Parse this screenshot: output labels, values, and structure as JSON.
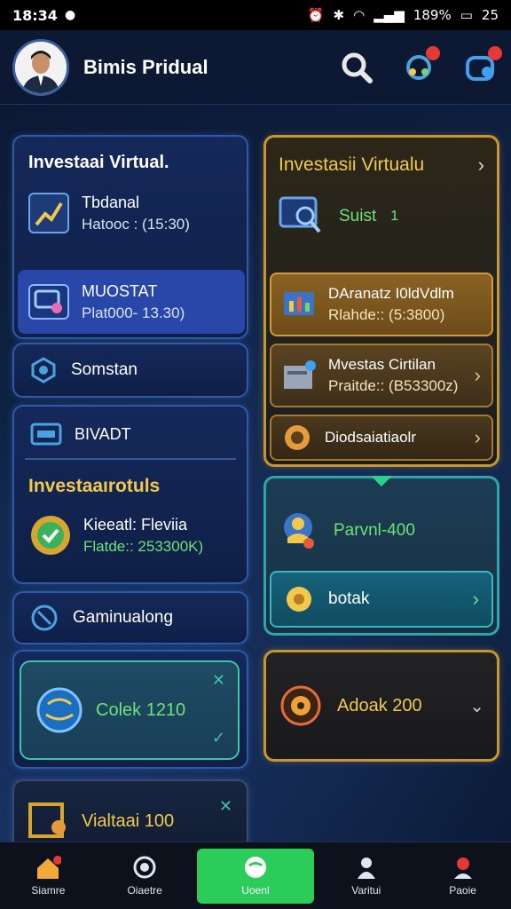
{
  "status": {
    "time": "18:34",
    "battery": "189%",
    "extra": "25"
  },
  "header": {
    "title": "Bimis Pridual"
  },
  "left": {
    "card1": {
      "title": "Investaai Virtual.",
      "item1_title": "Tbdanal",
      "item1_sub": "Hatooc : (15:30)",
      "item2_title": "MUOSTAT",
      "item2_sub": "Plat000- 13.30)"
    },
    "card2": {
      "label": "Somstan"
    },
    "card3": {
      "label": "BIVADT",
      "heading": "Investaaırotuls",
      "item_title": "Kieeatl: Fleviia",
      "item_sub": "Flatde:: 253300K)"
    },
    "card4": {
      "label": "Gaminualong"
    },
    "card5": {
      "label": "Colek 1210"
    },
    "card6": {
      "label": "Vialtaai 100"
    }
  },
  "right": {
    "card1": {
      "title": "Investasii Virtualu",
      "item1": "Suist",
      "item1_num": "1",
      "row1_title": "DAranatz I0ldVdlm",
      "row1_sub": "Rlahde:: (5:3800)",
      "row2_title": "Mvestas Cirtilan",
      "row2_sub": "Praitde:: (B53300z)",
      "row3_title": "Diodsaiatiaolr"
    },
    "card2": {
      "label": "Parvnl-400",
      "sub_label": "botak"
    },
    "card3": {
      "label": "Adoak 200"
    }
  },
  "nav": [
    {
      "label": "Siamre"
    },
    {
      "label": "Oiaetre"
    },
    {
      "label": "Uoenl"
    },
    {
      "label": "Varitui"
    },
    {
      "label": "Paoie"
    }
  ]
}
